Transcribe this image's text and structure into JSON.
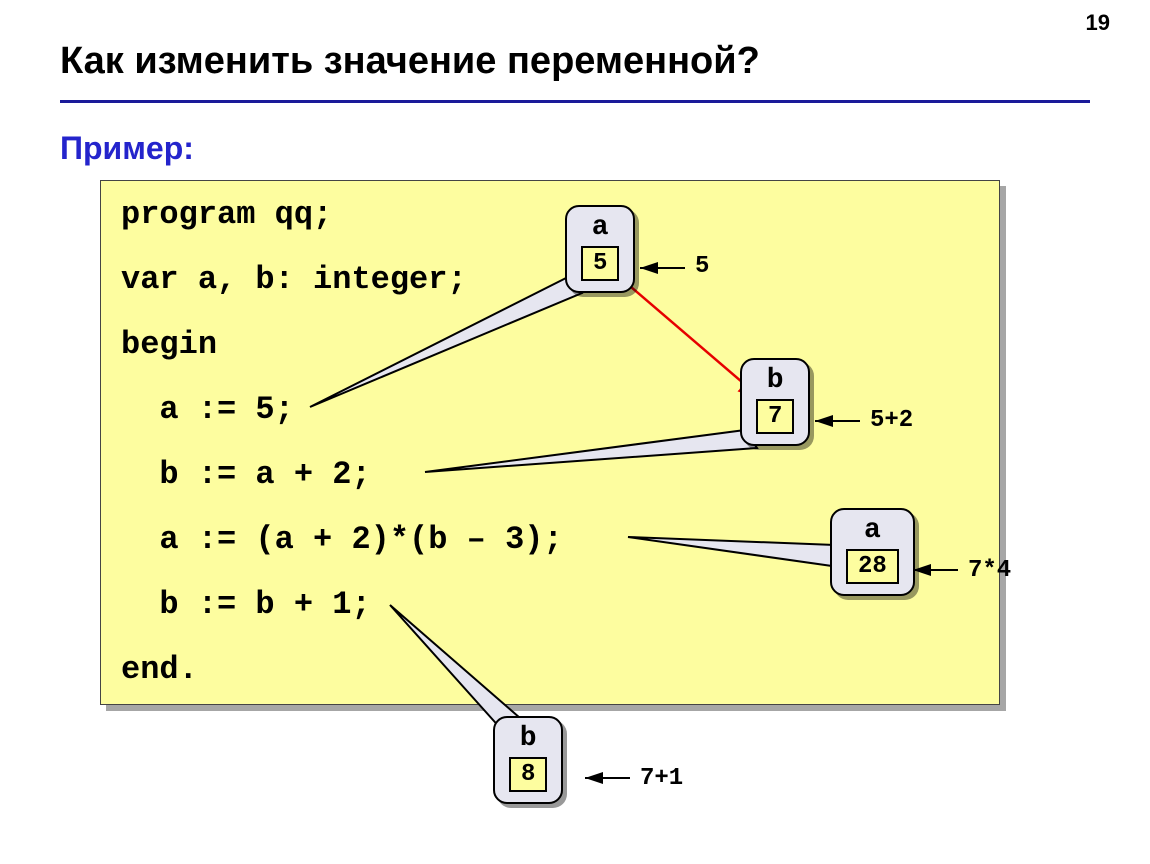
{
  "page_number": "19",
  "title": "Как изменить значение переменной?",
  "subtitle": "Пример:",
  "code": {
    "l1": "program qq;",
    "l2": "var a, b: integer;",
    "l3": "begin",
    "l4": "  a := 5;",
    "l5": "  b := a + 2;",
    "l6": "  a := (a + 2)*(b – 3);",
    "l7": "  b := b + 1;",
    "l8": "end."
  },
  "callouts": {
    "c1": {
      "var": "a",
      "val": "5",
      "annot": "5"
    },
    "c2": {
      "var": "b",
      "val": "7",
      "annot": "5+2"
    },
    "c3": {
      "var": "a",
      "val": "28",
      "annot": "7*4"
    },
    "c4": {
      "var": "b",
      "val": "8",
      "annot": "7+1"
    }
  }
}
